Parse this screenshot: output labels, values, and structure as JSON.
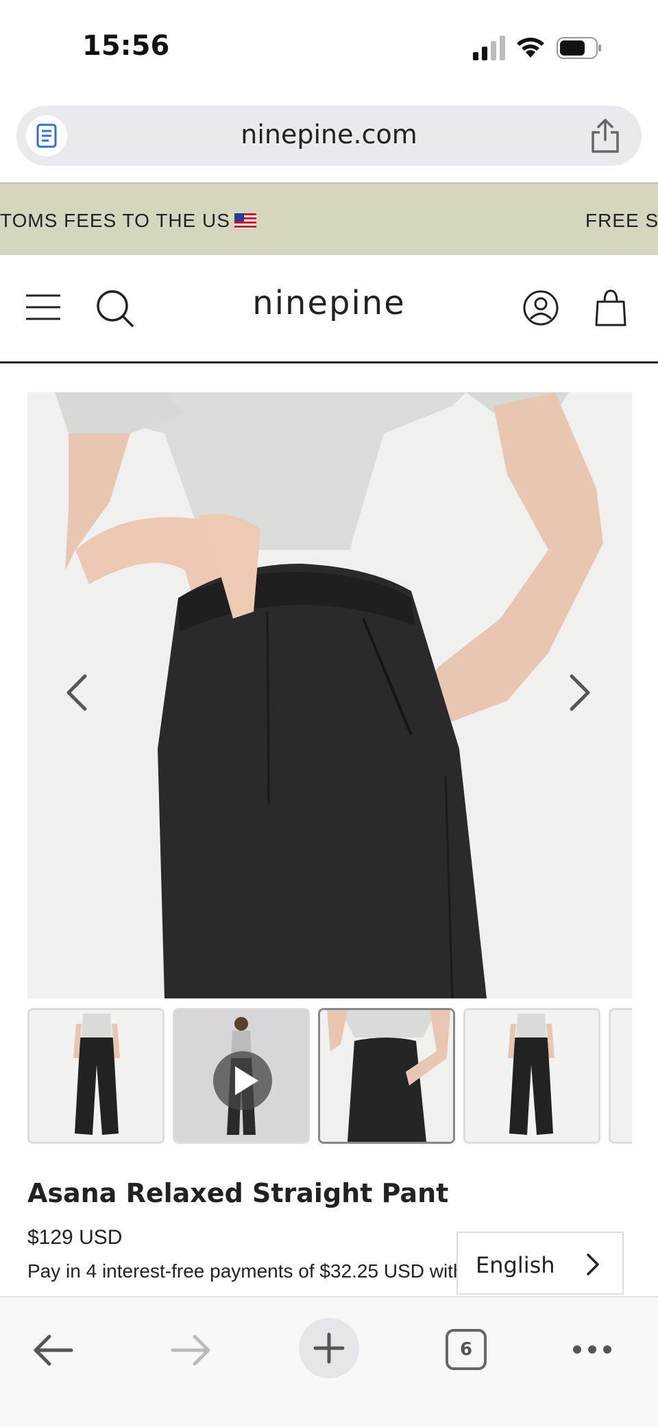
{
  "status_bar": {
    "time": "15:56",
    "icons": [
      "signal-icon",
      "wifi-icon",
      "battery-icon"
    ]
  },
  "browser": {
    "url": "ninepine.com",
    "reader_icon": "reader-icon",
    "share_icon": "share-icon"
  },
  "announcement": {
    "left_text": "TOMS FEES TO THE US",
    "right_text": "FREE SI",
    "background": "#d6d6bf"
  },
  "header": {
    "logo": "ninepine",
    "icons": [
      "menu-icon",
      "search-icon",
      "account-icon",
      "cart-icon"
    ]
  },
  "gallery": {
    "thumbnail_count": 5,
    "active_index": 2,
    "video_thumbnail_index": 1
  },
  "product": {
    "title": "Asana Relaxed Straight Pant",
    "price": "$129 USD",
    "installments": "Pay in 4 interest-free payments of $32.25 USD with"
  },
  "language_selector": {
    "label": "English"
  },
  "toolbar": {
    "tab_count": "6",
    "icons": [
      "back-icon",
      "forward-icon",
      "new-tab-icon",
      "tabs-icon",
      "more-icon"
    ]
  }
}
